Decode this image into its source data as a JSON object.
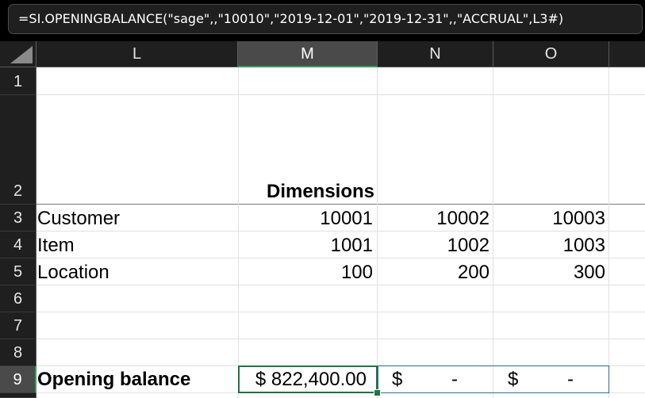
{
  "formula_bar": {
    "formula": "=SI.OPENINGBALANCE(\"sage\",,\"10010\",\"2019-12-01\",\"2019-12-31\",,\"ACCRUAL\",L3#)"
  },
  "columns": [
    "L",
    "M",
    "N",
    "O"
  ],
  "selected_column": "M",
  "rows": [
    "1",
    "2",
    "3",
    "4",
    "5",
    "6",
    "7",
    "8",
    "9"
  ],
  "selected_row": "9",
  "cells": {
    "M2": "Dimensions",
    "L3": "Customer",
    "M3": "10001",
    "N3": "10002",
    "O3": "10003",
    "L4": "Item",
    "M4": "1001",
    "N4": "1002",
    "O4": "1003",
    "L5": "Location",
    "M5": "100",
    "N5": "200",
    "O5": "300",
    "L9": "Opening balance",
    "M9": "$ 822,400.00",
    "N9_symbol": "$",
    "N9_value": "-",
    "O9_symbol": "$",
    "O9_value": "-"
  },
  "colors": {
    "selection": "#217346",
    "header_bg": "#1f1f1f",
    "selected_header_bg": "#4a4a4a"
  }
}
